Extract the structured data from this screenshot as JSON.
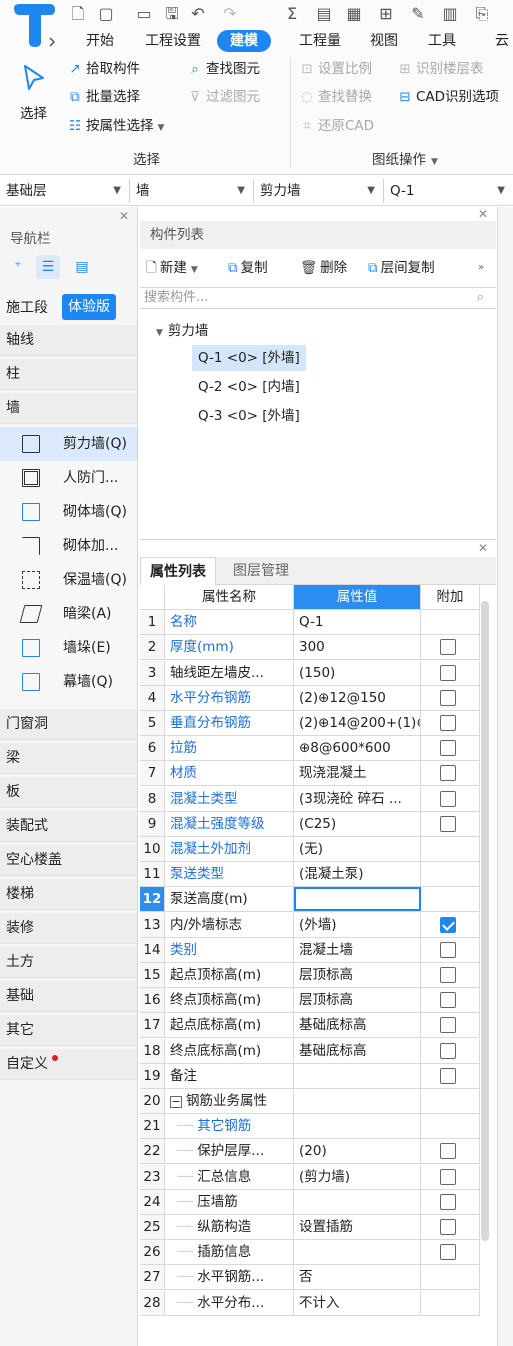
{
  "menu": {
    "tabs": [
      {
        "label": "开始"
      },
      {
        "label": "工程设置"
      },
      {
        "label": "建模"
      },
      {
        "label": "工程量"
      },
      {
        "label": "视图"
      },
      {
        "label": "工具"
      },
      {
        "label": "云"
      }
    ]
  },
  "ribbon": {
    "select_label": "选择",
    "pick_component": "拾取构件",
    "find_element": "查找图元",
    "batch_select": "批量选择",
    "filter_element": "过滤图元",
    "select_by_attr": "按属性选择",
    "set_scale": "设置比例",
    "identify_floor_table": "识别楼层表",
    "find_replace": "查找替换",
    "cad_identify_options": "CAD识别选项",
    "restore_cad": "还原CAD",
    "group_select": "选择",
    "group_drawing_ops": "图纸操作"
  },
  "selectors": {
    "floor": "基础层",
    "category": "墙",
    "type": "剪力墙",
    "component": "Q-1"
  },
  "nav": {
    "title": "导航栏",
    "stage_label": "施工段",
    "stage_badge": "体验版",
    "categories_top": [
      "轴线",
      "柱",
      "墙"
    ],
    "wall_items": [
      {
        "label": "剪力墙(Q)",
        "icon": "shear-wall-icon"
      },
      {
        "label": "人防门...",
        "icon": "civil-defense-door-icon"
      },
      {
        "label": "砌体墙(Q)",
        "icon": "masonry-wall-icon"
      },
      {
        "label": "砌体加...",
        "icon": "masonry-reinforce-icon"
      },
      {
        "label": "保温墙(Q)",
        "icon": "insulation-wall-icon"
      },
      {
        "label": "暗梁(A)",
        "icon": "hidden-beam-icon"
      },
      {
        "label": "墙垛(E)",
        "icon": "wall-pier-icon"
      },
      {
        "label": "幕墙(Q)",
        "icon": "curtain-wall-icon"
      }
    ],
    "categories_bottom": [
      "门窗洞",
      "梁",
      "板",
      "装配式",
      "空心楼盖",
      "楼梯",
      "装修",
      "土方",
      "基础",
      "其它",
      "自定义"
    ]
  },
  "component_list": {
    "title": "构件列表",
    "new": "新建",
    "copy": "复制",
    "delete": "删除",
    "floor_copy": "层间复制",
    "search_placeholder": "搜索构件...",
    "tree_root": "剪力墙",
    "items": [
      "Q-1 <0> [外墙]",
      "Q-2 <0> [内墙]",
      "Q-3 <0> [外墙]"
    ]
  },
  "properties": {
    "tab_active": "属性列表",
    "tab_inactive": "图层管理",
    "col_name": "属性名称",
    "col_value": "属性值",
    "col_add": "附加",
    "rows": [
      {
        "num": "1",
        "name": "名称",
        "value": "Q-1",
        "blue": true,
        "checkbox": "none"
      },
      {
        "num": "2",
        "name": "厚度(mm)",
        "value": "300",
        "blue": true,
        "checkbox": "off"
      },
      {
        "num": "3",
        "name": "轴线距左墙皮...",
        "value": "(150)",
        "blue": false,
        "checkbox": "off"
      },
      {
        "num": "4",
        "name": "水平分布钢筋",
        "value": "(2)⊕12@150",
        "blue": true,
        "checkbox": "off"
      },
      {
        "num": "5",
        "name": "垂直分布钢筋",
        "value": "(2)⊕14@200+(1)⊕",
        "blue": true,
        "checkbox": "off"
      },
      {
        "num": "6",
        "name": "拉筋",
        "value": "⊕8@600*600",
        "blue": true,
        "checkbox": "off"
      },
      {
        "num": "7",
        "name": "材质",
        "value": "现浇混凝土",
        "blue": true,
        "checkbox": "off"
      },
      {
        "num": "8",
        "name": "混凝土类型",
        "value": "(3现浇砼 碎石 ...",
        "blue": true,
        "checkbox": "off"
      },
      {
        "num": "9",
        "name": "混凝土强度等级",
        "value": "(C25)",
        "blue": true,
        "checkbox": "off"
      },
      {
        "num": "10",
        "name": "混凝土外加剂",
        "value": "(无)",
        "blue": true,
        "checkbox": "none"
      },
      {
        "num": "11",
        "name": "泵送类型",
        "value": "(混凝土泵)",
        "blue": true,
        "checkbox": "none"
      },
      {
        "num": "12",
        "name": "泵送高度(m)",
        "value": "",
        "blue": false,
        "checkbox": "none"
      },
      {
        "num": "13",
        "name": "内/外墙标志",
        "value": "(外墙)",
        "blue": false,
        "checkbox": "on"
      },
      {
        "num": "14",
        "name": "类别",
        "value": "混凝土墙",
        "blue": true,
        "checkbox": "off"
      },
      {
        "num": "15",
        "name": "起点顶标高(m)",
        "value": "层顶标高",
        "blue": false,
        "checkbox": "off"
      },
      {
        "num": "16",
        "name": "终点顶标高(m)",
        "value": "层顶标高",
        "blue": false,
        "checkbox": "off"
      },
      {
        "num": "17",
        "name": "起点底标高(m)",
        "value": "基础底标高",
        "blue": false,
        "checkbox": "off"
      },
      {
        "num": "18",
        "name": "终点底标高(m)",
        "value": "基础底标高",
        "blue": false,
        "checkbox": "off"
      },
      {
        "num": "19",
        "name": "备注",
        "value": "",
        "blue": false,
        "checkbox": "off"
      },
      {
        "num": "20",
        "name": "钢筋业务属性",
        "value": "",
        "blue": false,
        "checkbox": "none",
        "expander": true
      },
      {
        "num": "21",
        "name": "其它钢筋",
        "value": "",
        "blue": true,
        "checkbox": "none",
        "indent": true
      },
      {
        "num": "22",
        "name": "保护层厚...",
        "value": "(20)",
        "blue": false,
        "checkbox": "off",
        "indent": true
      },
      {
        "num": "23",
        "name": "汇总信息",
        "value": "(剪力墙)",
        "blue": false,
        "checkbox": "off",
        "indent": true
      },
      {
        "num": "24",
        "name": "压墙筋",
        "value": "",
        "blue": false,
        "checkbox": "off",
        "indent": true
      },
      {
        "num": "25",
        "name": "纵筋构造",
        "value": "设置插筋",
        "blue": false,
        "checkbox": "off",
        "indent": true
      },
      {
        "num": "26",
        "name": "插筋信息",
        "value": "",
        "blue": false,
        "checkbox": "off",
        "indent": true
      },
      {
        "num": "27",
        "name": "水平钢筋...",
        "value": "否",
        "blue": false,
        "checkbox": "none",
        "indent": true
      },
      {
        "num": "28",
        "name": "水平分布...",
        "value": "不计入",
        "blue": false,
        "checkbox": "none",
        "indent": true
      }
    ]
  }
}
